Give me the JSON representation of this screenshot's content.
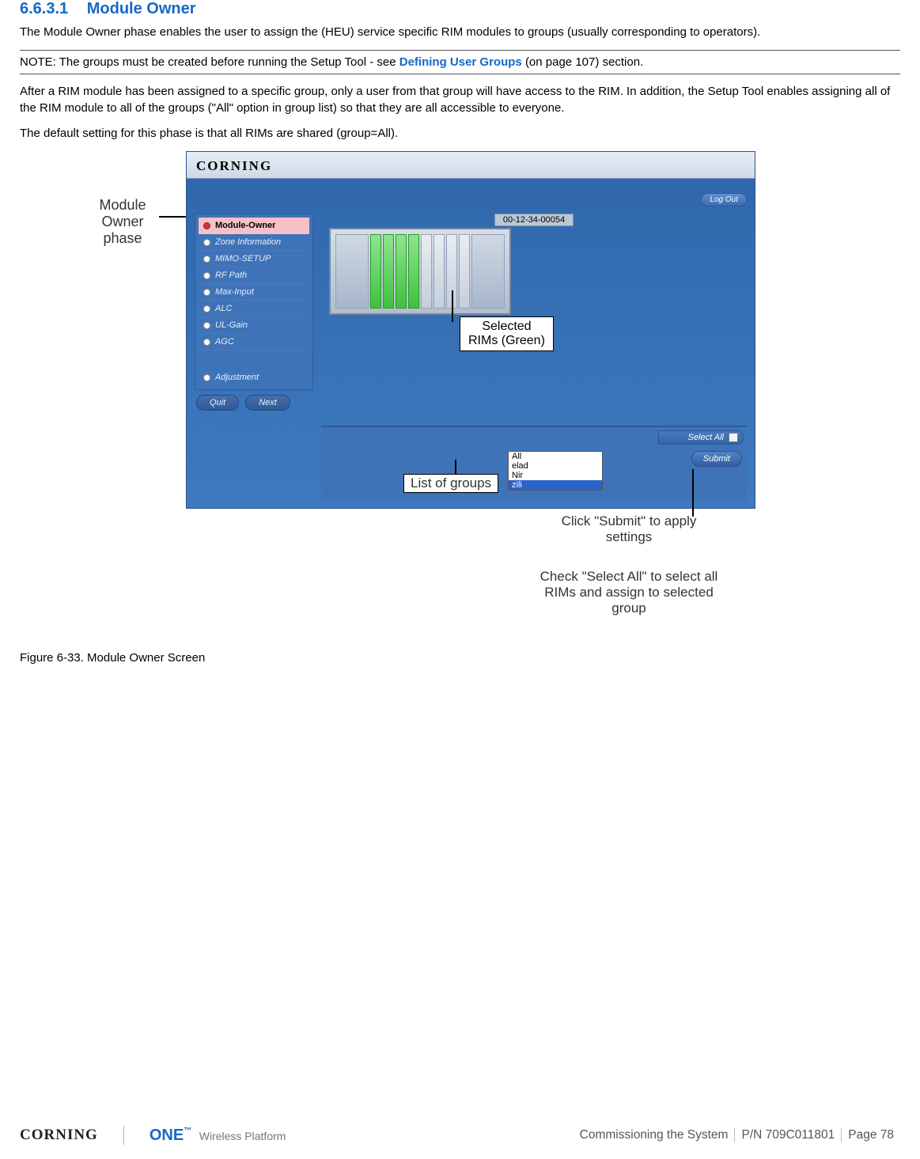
{
  "section": {
    "number": "6.6.3.1",
    "title": "Module Owner"
  },
  "para1": "The Module Owner phase enables the user to assign the (HEU) service specific RIM modules to groups (usually corresponding to operators).",
  "note": {
    "prefix": "NOTE: The groups must be created before running the Setup Tool - see ",
    "link": "Defining User Groups",
    "suffix": " (on page 107) section."
  },
  "para2": "After a RIM module has been assigned to a specific group, only a user from that group will have access to the RIM. In addition, the Setup Tool enables assigning all of the RIM module to all of the groups (\"All\" option in group list) so that they are all accessible to everyone.",
  "para3": "The default setting for this phase is that all RIMs are shared (group=All).",
  "figure": {
    "phase_label_line1": "Module",
    "phase_label_line2": "Owner",
    "phase_label_line3": "phase",
    "app_brand": "CORNING",
    "logout": "Log Out",
    "mac": "00-12-34-00054",
    "sidebar": [
      {
        "label": "Module-Owner",
        "selected": true
      },
      {
        "label": "Zone Information",
        "selected": false
      },
      {
        "label": "MIMO-SETUP",
        "selected": false
      },
      {
        "label": "RF Path",
        "selected": false
      },
      {
        "label": "Max-Input",
        "selected": false
      },
      {
        "label": "ALC",
        "selected": false
      },
      {
        "label": "UL-Gain",
        "selected": false
      },
      {
        "label": "AGC",
        "selected": false
      }
    ],
    "sidebar_extra": "Adjustment",
    "quit": "Quit",
    "next": "Next",
    "rim_callout_line1": "Selected",
    "rim_callout_line2": "RIMs (Green)",
    "select_all": "Select All",
    "group_options": [
      "All",
      "elad",
      "Nir",
      "zili"
    ],
    "group_selected_index": 3,
    "submit": "Submit",
    "annot_listgroups": "List of groups",
    "annot_submit": "Click \"Submit\" to apply settings",
    "annot_selectall": "Check \"Select All\" to select all RIMs and assign to selected group",
    "caption": "Figure 6-33. Module Owner Screen"
  },
  "footer": {
    "corning": "CORNING",
    "one": "ONE",
    "one_sub": "Wireless Platform",
    "chapter": "Commissioning the System",
    "pn": "P/N 709C011801",
    "page": "Page 78"
  }
}
